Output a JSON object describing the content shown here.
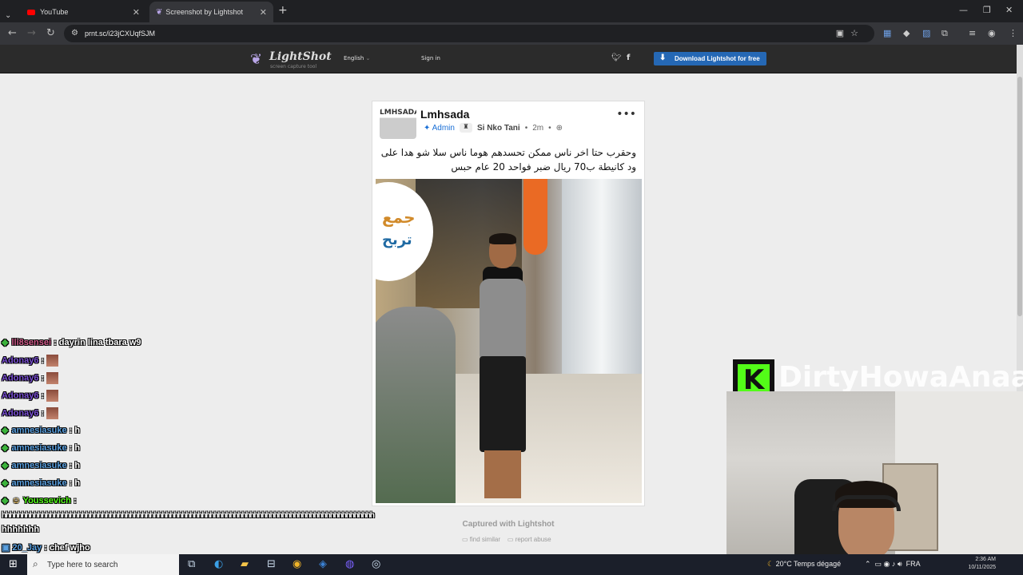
{
  "browser": {
    "tabs": [
      {
        "title": "YouTube",
        "icon": "youtube-icon"
      },
      {
        "title": "Screenshot by Lightshot",
        "icon": "lightshot-feather-icon"
      }
    ],
    "url": "prnt.sc/i23jCXUqfSJM"
  },
  "lightshot": {
    "logo_name": "LightShot",
    "logo_tagline": "screen capture tool",
    "language": "English",
    "sign_in": "Sign in",
    "download_label": "Download Lightshot for free",
    "captured": "Captured with Lightshot",
    "find_similar": "find similar",
    "report_abuse": "report abuse"
  },
  "post": {
    "avatar_text": "LMHSADA",
    "page_name": "Lmhsada",
    "admin": "Admin",
    "author": "Si Nko Tani",
    "time": "2m",
    "text": "وحقرب حتا اخر ناس ممكن تحسدهم هوما ناس سلا شو هدا على ود كانيطة ب70 ريال ضبر فواحد 20 عام حبس",
    "photo_overlay_1": "جمع",
    "photo_overlay_2": "تربح"
  },
  "chat": [
    {
      "user": "lli8sensei",
      "msg": ": dayrin lina tbara w9",
      "color": "#d05a8a"
    },
    {
      "user": "Adonay6",
      "msg": ":",
      "color": "#7b4fd6",
      "emote": true
    },
    {
      "user": "Adonay6",
      "msg": ":",
      "color": "#7b4fd6",
      "emote": true
    },
    {
      "user": "Adonay6",
      "msg": ":",
      "color": "#7b4fd6",
      "emote": true
    },
    {
      "user": "Adonay6",
      "msg": ":",
      "color": "#7b4fd6",
      "emote": true
    },
    {
      "user": "amnesiasuke",
      "msg": ": h",
      "color": "#5aa0e0"
    },
    {
      "user": "amnesiasuke",
      "msg": ": h",
      "color": "#5aa0e0"
    },
    {
      "user": "amnesiasuke",
      "msg": ": h",
      "color": "#5aa0e0"
    },
    {
      "user": "amnesiasuke",
      "msg": ": h",
      "color": "#5aa0e0"
    },
    {
      "user": "Youssevich",
      "msg": ":",
      "color": "#53fc18"
    },
    {
      "user": "",
      "msg": "hhhhhhhhhhhhhhhhhhhhhhhhhhhhhhhhhhhhhhhhhhhhhhhhhhhhhhhhhhhhhhhhhhhhhhhhhhhhhhhhhhhhhhhhhhhhh",
      "color": "#ffffff"
    },
    {
      "user": "",
      "msg": "hhhhhhh",
      "color": "#ffffff"
    },
    {
      "user": "20_Jay",
      "msg": ": chef wjho",
      "color": "#5aa0e0"
    }
  ],
  "stream": {
    "channel_name": "DirtyHowaAnaa",
    "kick_letter": "K"
  },
  "taskbar": {
    "search_placeholder": "Type here to search",
    "weather": "20°C  Temps dégagé",
    "lang": "FRA",
    "time": "2:36 AM",
    "date": "10/11/2025"
  }
}
